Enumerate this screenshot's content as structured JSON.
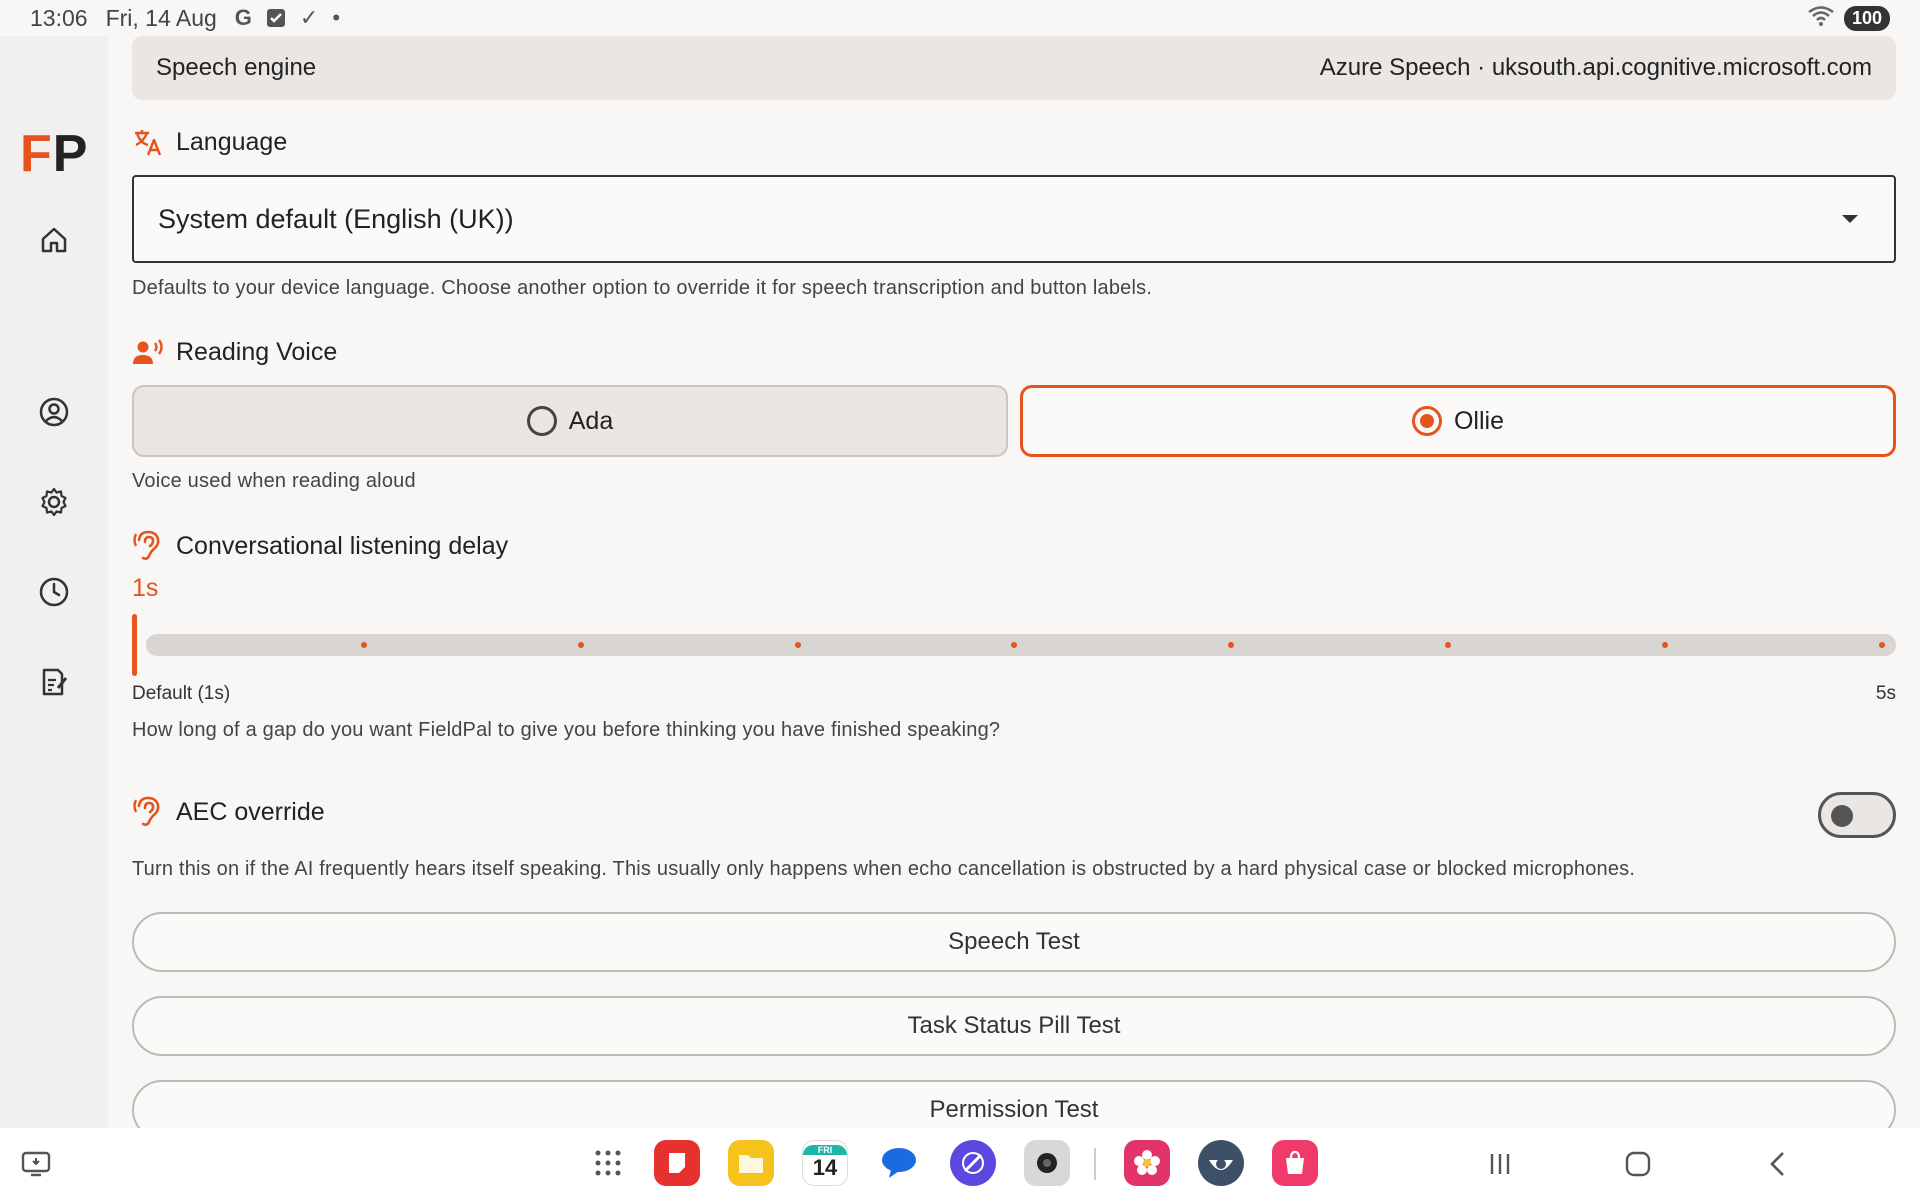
{
  "status_bar": {
    "time": "13:06",
    "date": "Fri, 14 Aug",
    "battery": "100"
  },
  "sidebar": {
    "logo_f": "F",
    "logo_p": "P",
    "items": [
      "home-icon",
      "profile-icon",
      "settings-icon",
      "history-icon",
      "report-icon"
    ]
  },
  "speech_engine": {
    "label": "Speech engine",
    "value": "Azure Speech · uksouth.api.cognitive.microsoft.com"
  },
  "language": {
    "title": "Language",
    "selected": "System default (English (UK))",
    "helper": "Defaults to your device language. Choose another option to override it for speech transcription and button labels."
  },
  "reading_voice": {
    "title": "Reading Voice",
    "options": [
      {
        "label": "Ada",
        "selected": false
      },
      {
        "label": "Ollie",
        "selected": true
      }
    ],
    "helper": "Voice used when reading aloud"
  },
  "listening_delay": {
    "title": "Conversational listening delay",
    "value_label": "1s",
    "value": 1,
    "min": 1,
    "max": 5,
    "min_label": "Default (1s)",
    "max_label": "5s",
    "helper": "How long of a gap do you want FieldPal to give you before thinking you have finished speaking?"
  },
  "aec_override": {
    "title": "AEC override",
    "enabled": false,
    "helper": "Turn this on if the AI frequently hears itself speaking. This usually only happens when echo cancellation is obstructed by a hard physical case or blocked microphones."
  },
  "buttons": {
    "speech_test": "Speech Test",
    "task_status_pill_test": "Task Status Pill Test",
    "permission_test": "Permission Test"
  },
  "dock": {
    "calendar_day": "14",
    "calendar_dow": "FRI"
  },
  "colors": {
    "accent": "#e5541c",
    "background": "#f8f7f6",
    "panel": "#e9e6e3"
  }
}
